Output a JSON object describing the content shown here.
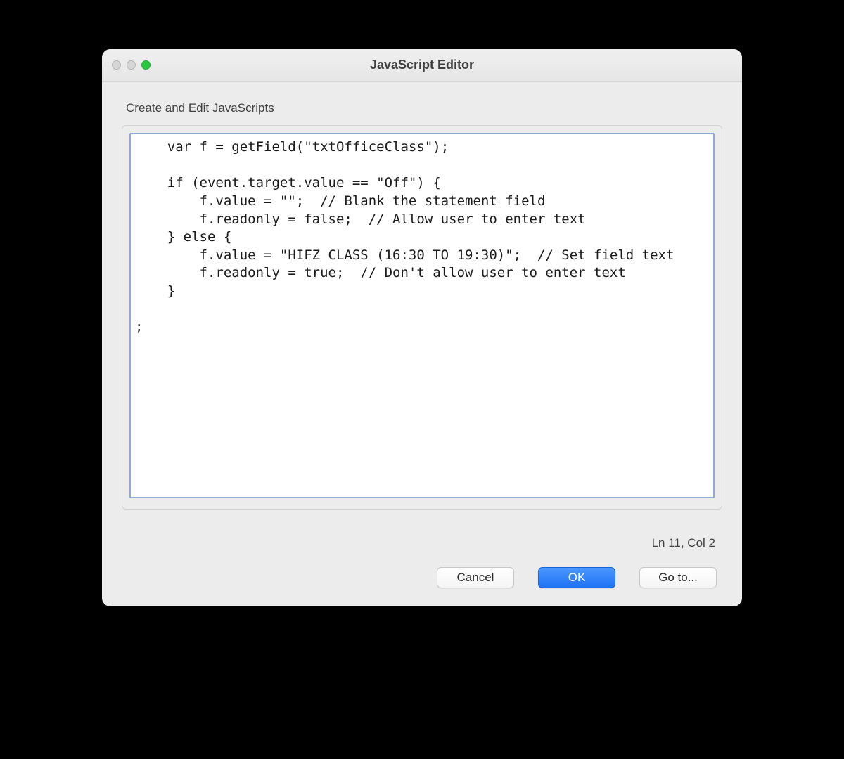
{
  "window": {
    "title": "JavaScript Editor"
  },
  "section": {
    "label": "Create and Edit JavaScripts"
  },
  "editor": {
    "code": "    var f = getField(\"txtOfficeClass\");\n\n    if (event.target.value == \"Off\") {\n        f.value = \"\";  // Blank the statement field\n        f.readonly = false;  // Allow user to enter text\n    } else {\n        f.value = \"HIFZ CLASS (16:30 TO 19:30)\";  // Set field text\n        f.readonly = true;  // Don't allow user to enter text\n    }\n\n;"
  },
  "status": {
    "position": "Ln 11, Col 2"
  },
  "buttons": {
    "cancel": "Cancel",
    "ok": "OK",
    "goto": "Go to..."
  }
}
